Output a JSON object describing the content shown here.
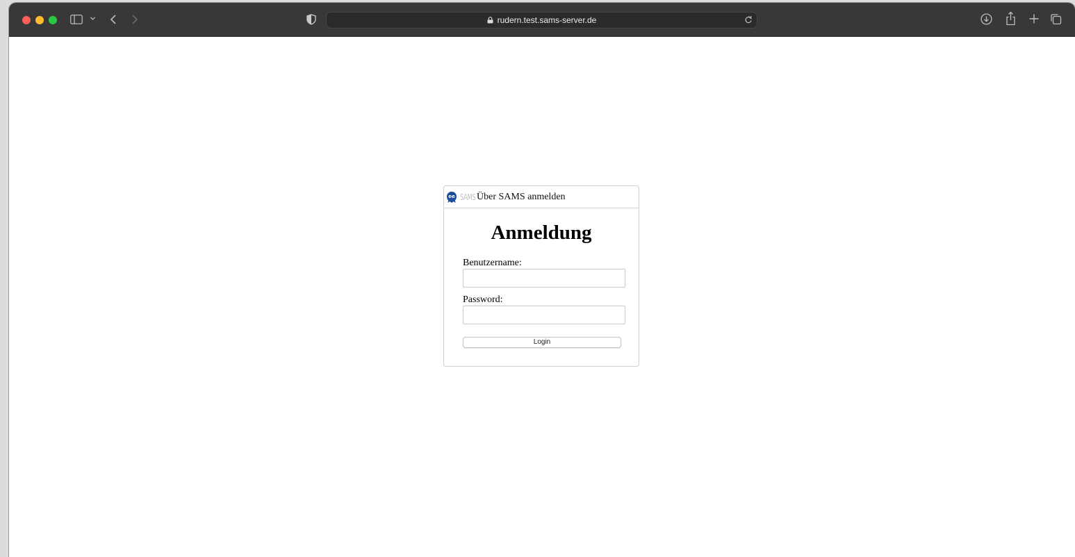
{
  "browser": {
    "url": "rudern.test.sams-server.de",
    "icons": {
      "sidebar": "sidebar-icon",
      "chevron": "chevron-down-icon",
      "back": "chevron-left-icon",
      "forward": "chevron-right-icon",
      "privacy": "shield-icon",
      "lock": "lock-icon",
      "reload": "reload-icon",
      "download": "download-icon",
      "share": "share-icon",
      "new_tab": "plus-icon",
      "tab_overview": "tabs-icon"
    }
  },
  "login": {
    "header_logo_text": "SAMS",
    "header_title": "Über SAMS anmelden",
    "title": "Anmeldung",
    "username_label": "Benutzername:",
    "username_value": "",
    "password_label": "Password:",
    "password_value": "",
    "submit_label": "Login"
  },
  "colors": {
    "toolbar": "#383838",
    "logo_blue": "#1d4f9c"
  }
}
